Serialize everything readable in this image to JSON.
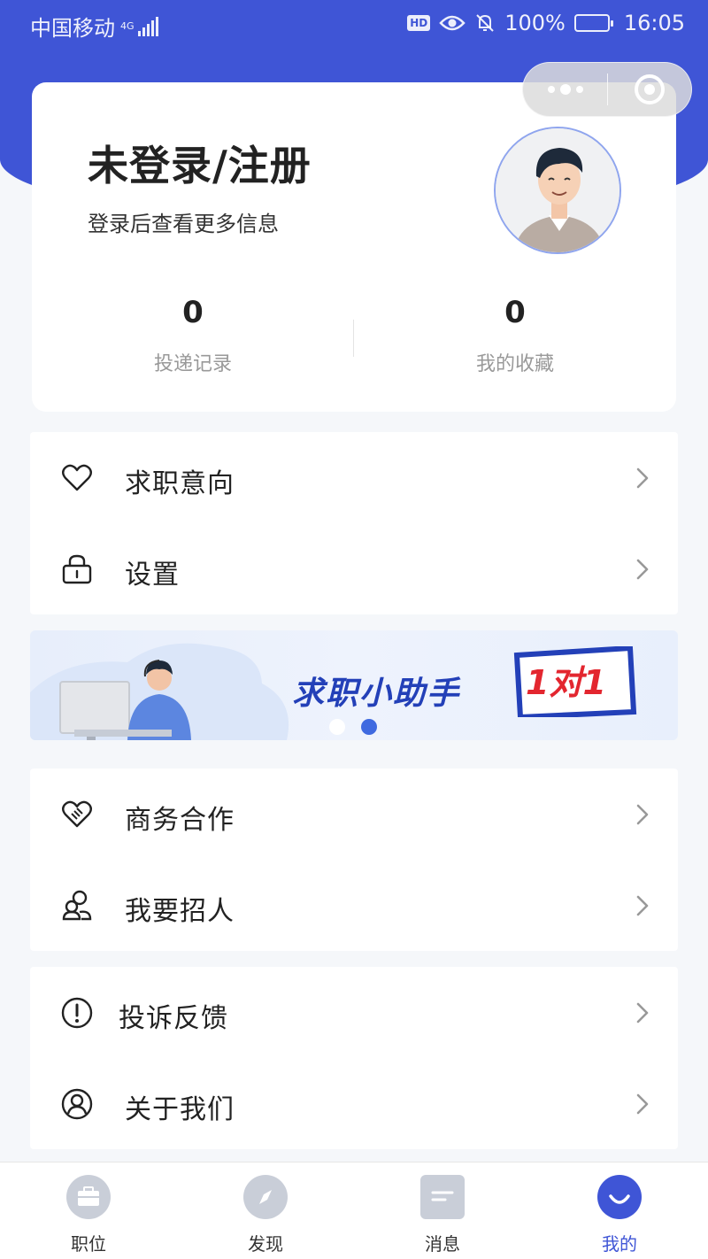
{
  "status_bar": {
    "carrier": "中国移动",
    "network": "4G",
    "battery": "100%",
    "time": "16:05"
  },
  "profile": {
    "title": "未登录/注册",
    "subtitle": "登录后查看更多信息",
    "stats": [
      {
        "value": "0",
        "label": "投递记录"
      },
      {
        "value": "0",
        "label": "我的收藏"
      }
    ]
  },
  "menu_group_1": [
    {
      "label": "求职意向",
      "icon": "heart-icon"
    },
    {
      "label": "设置",
      "icon": "lock-icon"
    }
  ],
  "banner": {
    "title": "求职小助手",
    "badge": "1对1",
    "active_slide": 2,
    "slide_count": 2
  },
  "menu_group_2": [
    {
      "label": "商务合作",
      "icon": "handshake-heart-icon"
    },
    {
      "label": "我要招人",
      "icon": "people-icon"
    }
  ],
  "menu_group_3": [
    {
      "label": "投诉反馈",
      "icon": "alert-circle-icon"
    },
    {
      "label": "关于我们",
      "icon": "user-circle-icon"
    }
  ],
  "tabbar": {
    "tabs": [
      {
        "label": "职位",
        "icon": "briefcase-icon"
      },
      {
        "label": "发现",
        "icon": "compass-icon"
      },
      {
        "label": "消息",
        "icon": "message-icon"
      },
      {
        "label": "我的",
        "icon": "smile-icon"
      }
    ],
    "active": "我的"
  },
  "colors": {
    "primary": "#3f55d6",
    "banner_text": "#2340b8",
    "badge_red": "#e3262f"
  }
}
